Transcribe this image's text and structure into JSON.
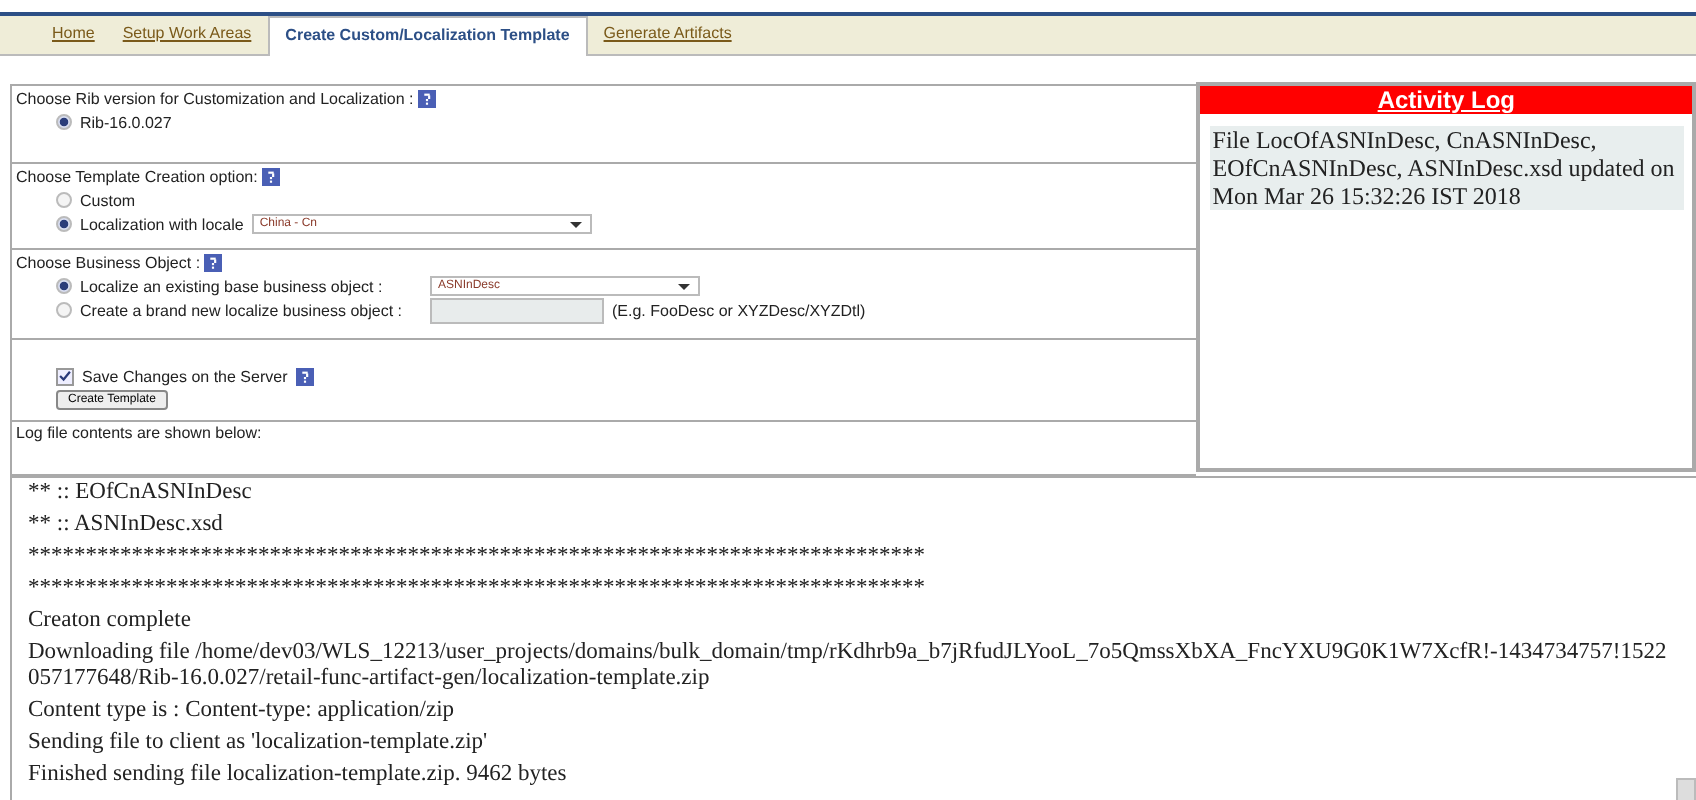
{
  "tabs": [
    {
      "label": "Home",
      "selected": false
    },
    {
      "label": "Setup Work Areas",
      "selected": false
    },
    {
      "label": "Create Custom/Localization Template",
      "selected": true
    },
    {
      "label": "Generate Artifacts",
      "selected": false
    }
  ],
  "rib_section": {
    "label": "Choose Rib version for Customization and Localization :",
    "options": [
      {
        "label": "Rib-16.0.027",
        "selected": true
      }
    ]
  },
  "template_section": {
    "label": "Choose Template Creation option:",
    "custom": {
      "label": "Custom",
      "selected": false
    },
    "localization": {
      "label": "Localization with locale",
      "selected": true,
      "value": "China - Cn"
    }
  },
  "business_section": {
    "label": "Choose Business Object :",
    "existing": {
      "label": "Localize an existing base business object :",
      "selected": true,
      "value": "ASNInDesc"
    },
    "new": {
      "label": "Create a brand new localize business object :",
      "selected": false,
      "hint": "(E.g. FooDesc or XYZDesc/XYZDtl)"
    }
  },
  "save_changes": {
    "label": "Save Changes on the Server",
    "checked": true
  },
  "create_button": "Create Template",
  "log_caption": "Log file contents are shown below:",
  "activity_log": {
    "title": "Activity Log",
    "message": "File LocOfASNInDesc, CnASNInDesc, EOfCnASNInDesc, ASNInDesc.xsd updated on Mon Mar 26 15:32:26 IST 2018"
  },
  "log_lines": [
    "** :: EOfCnASNInDesc",
    "** :: ASNInDesc.xsd",
    "******************************************************************************",
    "******************************************************************************",
    "Creaton complete",
    "Downloading file /home/dev03/WLS_12213/user_projects/domains/bulk_domain/tmp/rKdhrb9a_b7jRfudJLYooL_7o5QmssXbXA_FncYXU9G0K1W7XcfR!-1434734757!1522057177648/Rib-16.0.027/retail-func-artifact-gen/localization-template.zip",
    "Content type is : Content-type: application/zip",
    "Sending file to client as 'localization-template.zip'",
    "Finished sending file localization-template.zip. 9462 bytes"
  ]
}
